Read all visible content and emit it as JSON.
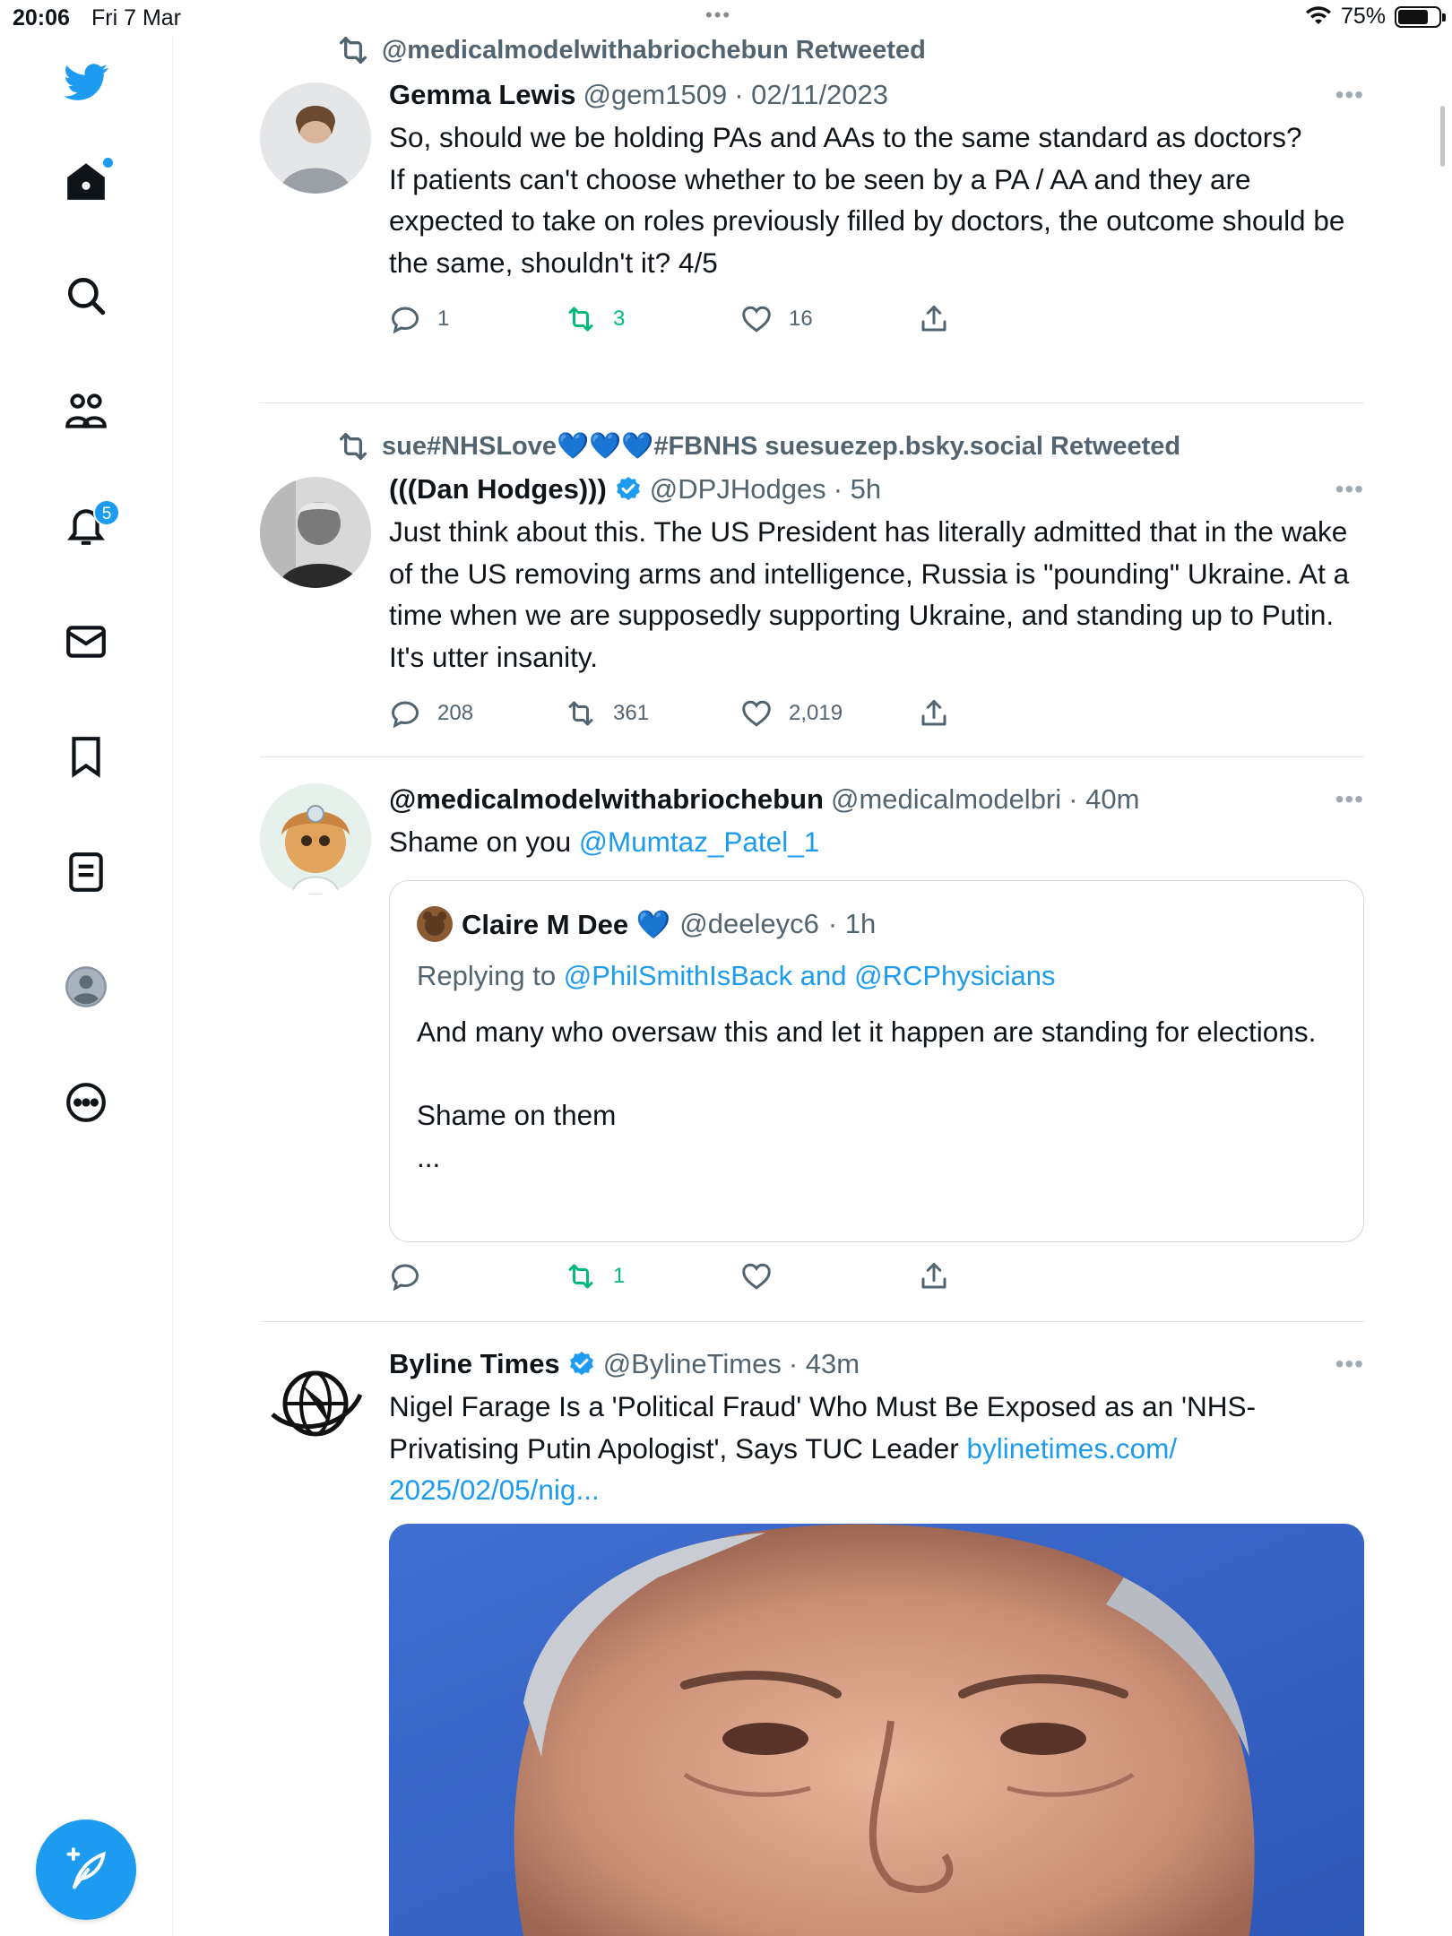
{
  "status_bar": {
    "time": "20:06",
    "date": "Fri 7 Mar",
    "battery": "75%",
    "battery_level": 0.75
  },
  "sidebar": {
    "notification_count": "5"
  },
  "tweets": [
    {
      "retweeted_by": "@medicalmodelwithabriochebun Retweeted",
      "name": "Gemma Lewis",
      "handle": "@gem1509",
      "time": "· 02/11/2023",
      "text": "So, should we be holding PAs and AAs to the same standard as doctors?\nIf patients can't choose whether to be seen by a PA / AA and they are expected to take on roles previously filled by doctors, the outcome should be the same, shouldn't it? 4/5",
      "replies": "1",
      "retweets": "3",
      "likes": "16"
    },
    {
      "retweeted_by": "sue#NHSLove💙💙💙#FBNHS suesuezep.bsky.social Retweeted",
      "name": "(((Dan Hodges)))",
      "handle": "@DPJHodges",
      "time": "· 5h",
      "text": "Just think about this. The US President has literally admitted that in the wake of the US removing arms and intelligence, Russia is \"pounding\" Ukraine. At a time when we are supposedly supporting Ukraine, and standing up to Putin. It's utter insanity.",
      "replies": "208",
      "retweets": "361",
      "likes": "2,019"
    },
    {
      "name": "@medicalmodelwithabriochebun",
      "handle": "@medicalmodelbri",
      "time": "· 40m",
      "text_plain": "Shame on you ",
      "text_link": "@Mumtaz_Patel_1",
      "retweets": "1",
      "quote": {
        "name": "Claire M Dee 💙",
        "handle": "@deeleyc6",
        "time": "· 1h",
        "replying_prefix": "Replying to ",
        "replying_to": "@PhilSmithIsBack and @RCPhysicians",
        "text": "And many who oversaw this and let it happen are standing for elections.\n\nShame on them\n..."
      }
    },
    {
      "name": "Byline Times",
      "handle": "@BylineTimes",
      "time": "· 43m",
      "text_plain": "Nigel Farage Is a 'Political Fraud' Who Must Be Exposed as an 'NHS-Privatising Putin Apologist', Says TUC Leader ",
      "text_link": "bylinetimes.com/\n2025/02/05/nig..."
    }
  ]
}
